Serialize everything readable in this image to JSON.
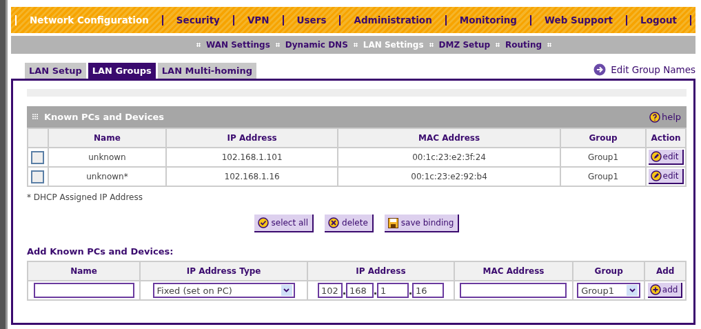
{
  "top_nav": [
    {
      "label": "Network Configuration",
      "selected": true
    },
    {
      "label": "Security",
      "selected": false
    },
    {
      "label": "VPN",
      "selected": false
    },
    {
      "label": "Users",
      "selected": false
    },
    {
      "label": "Administration",
      "selected": false
    },
    {
      "label": "Monitoring",
      "selected": false
    },
    {
      "label": "Web Support",
      "selected": false
    },
    {
      "label": "Logout",
      "selected": false
    }
  ],
  "sub_nav": [
    {
      "label": "WAN Settings",
      "selected": false
    },
    {
      "label": "Dynamic DNS",
      "selected": false
    },
    {
      "label": "LAN Settings",
      "selected": true
    },
    {
      "label": "DMZ Setup",
      "selected": false
    },
    {
      "label": "Routing",
      "selected": false
    }
  ],
  "tabs": [
    {
      "label": "LAN Setup",
      "selected": false
    },
    {
      "label": "LAN Groups",
      "selected": true
    },
    {
      "label": "LAN Multi-homing",
      "selected": false
    }
  ],
  "edit_group_names_link": "Edit Group Names",
  "known_devices": {
    "title": "Known PCs and Devices",
    "help": "help",
    "columns": [
      "Name",
      "IP Address",
      "MAC Address",
      "Group",
      "Action"
    ],
    "rows": [
      {
        "checked": false,
        "name": "unknown",
        "ip": "102.168.1.101",
        "mac": "00:1c:23:e2:3f:24",
        "group": "Group1",
        "action": "edit"
      },
      {
        "checked": false,
        "name": "unknown*",
        "ip": "102.168.1.16",
        "mac": "00:1c:23:e2:92:b4",
        "group": "Group1",
        "action": "edit"
      }
    ],
    "footnote": "* DHCP Assigned IP Address"
  },
  "buttons": [
    {
      "kind": "select",
      "label": "select all"
    },
    {
      "kind": "delete",
      "label": "delete"
    },
    {
      "kind": "save",
      "label": "save binding"
    }
  ],
  "add_section": {
    "title": "Add Known PCs and Devices:",
    "columns": [
      "Name",
      "IP Address Type",
      "IP Address",
      "MAC Address",
      "Group",
      "Add"
    ],
    "ip_type": "Fixed (set on PC)",
    "ip_octets": [
      "102",
      "168",
      "1",
      "16"
    ],
    "group": "Group1",
    "add_button": "add"
  }
}
